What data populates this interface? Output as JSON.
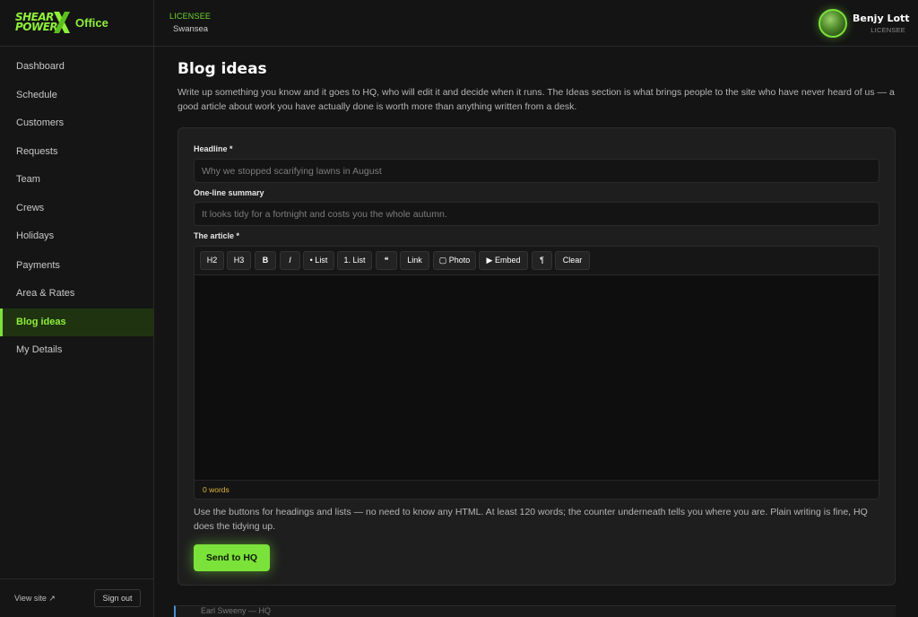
{
  "brand": {
    "logo_line1": "SHEAR",
    "logo_line2": "POWER",
    "section": "Office",
    "accent_color": "#7be23a"
  },
  "header": {
    "licensee_tag": "LICENSEE",
    "licensee_location": "Swansea",
    "user_name": "Benjy Lott",
    "user_role": "LICENSEE"
  },
  "sidebar": {
    "items": [
      {
        "label": "Dashboard"
      },
      {
        "label": "Schedule"
      },
      {
        "label": "Customers"
      },
      {
        "label": "Requests"
      },
      {
        "label": "Team"
      },
      {
        "label": "Crews"
      },
      {
        "label": "Holidays"
      },
      {
        "label": "Payments"
      },
      {
        "label": "Area & Rates"
      },
      {
        "label": "Blog ideas",
        "active": true
      },
      {
        "label": "My Details"
      }
    ],
    "view_site": "View site ↗",
    "sign_out": "Sign out"
  },
  "main": {
    "title": "Blog ideas",
    "intro": "Write up something you know and it goes to HQ, who will edit it and decide when it runs. The Ideas section is what brings people to the site who have never heard of us — a good article about work you have actually done is worth more than anything written from a desk.",
    "form": {
      "headline_label": "Headline *",
      "headline_placeholder": "Why we stopped scarifying lawns in August",
      "headline_value": "",
      "summary_label": "One-line summary",
      "summary_placeholder": "It looks tidy for a fortnight and costs you the whole autumn.",
      "summary_value": "",
      "article_label": "The article *",
      "toolbar": [
        "H2",
        "H3",
        "B",
        "I",
        "• List",
        "1. List",
        "❝",
        "Link",
        "▢ Photo",
        "▶ Embed",
        "¶",
        "Clear"
      ],
      "word_count": "0 words",
      "help": "Use the buttons for headings and lists — no need to know any HTML. At least 120 words; the counter underneath tells you where you are. Plain writing is fine, HQ does the tidying up.",
      "submit": "Send to HQ"
    },
    "below_peek": "Earl Sweeny — HQ"
  }
}
